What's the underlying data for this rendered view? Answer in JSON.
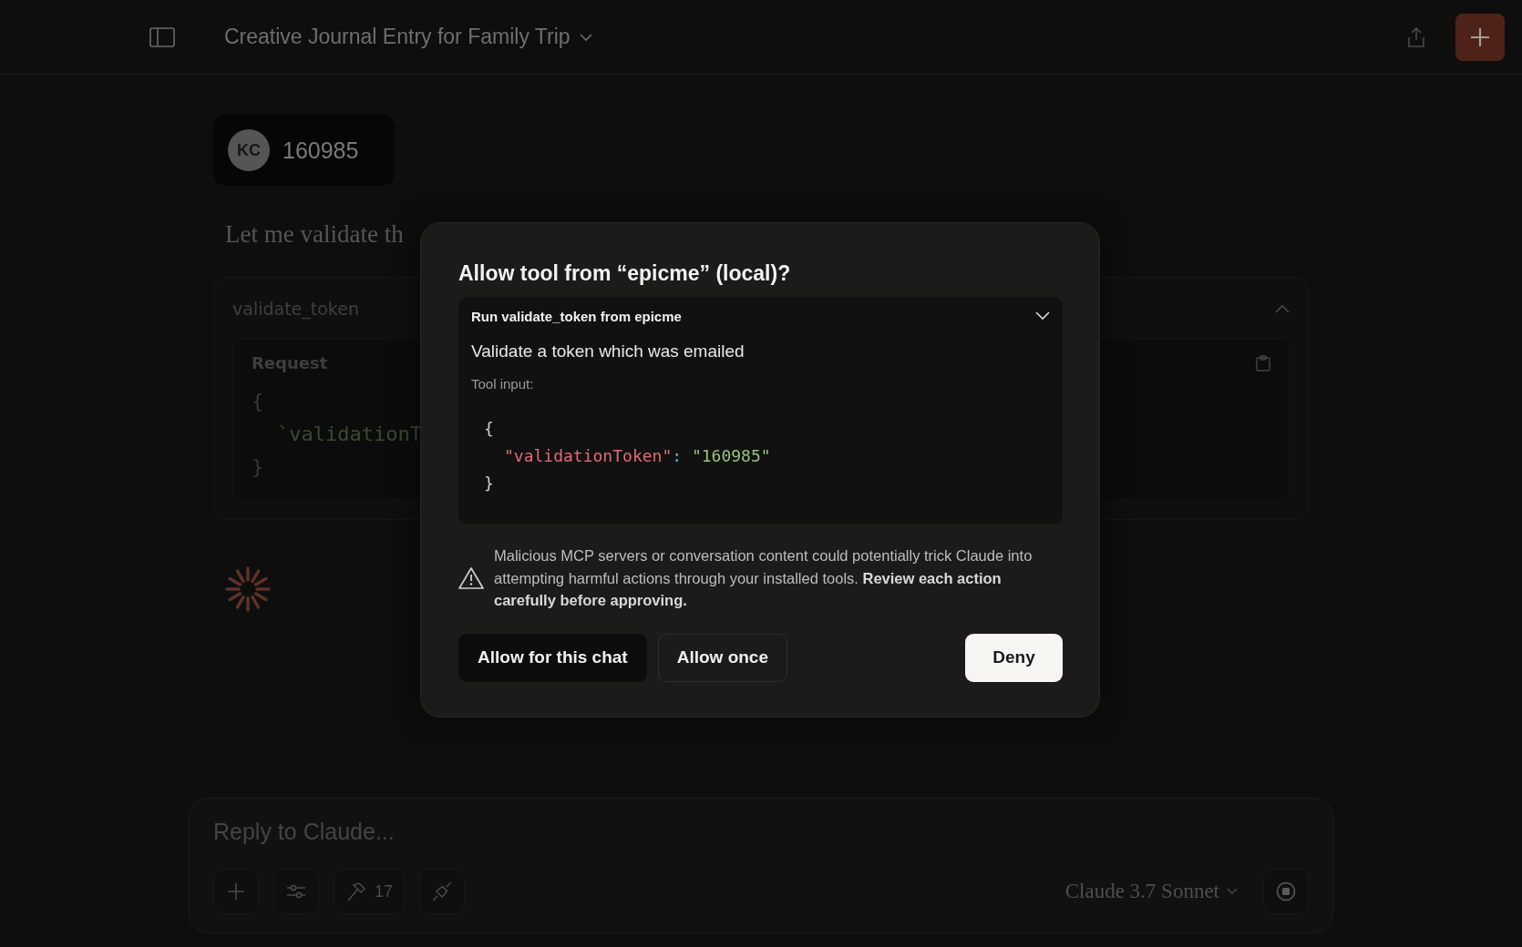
{
  "header": {
    "title": "Creative Journal Entry for Family Trip"
  },
  "messages": [
    {
      "kind": "user",
      "avatar": "KC",
      "text": "160985"
    },
    {
      "kind": "assistant",
      "text": "Let me validate th"
    }
  ],
  "tool_call": {
    "name": "validate_token",
    "expanded": true,
    "request_label": "Request",
    "lines": [
      "{",
      "`validationT",
      "}"
    ]
  },
  "dialog": {
    "title": "Allow tool from “epicme” (local)?",
    "tool_header": "Run validate_token from epicme",
    "description": "Validate a token which was emailed",
    "input_label": "Tool input:",
    "code": {
      "open": "{",
      "key": "\"validationToken\"",
      "colon": ":",
      "value": "\"160985\"",
      "close": "}"
    },
    "warning": "Malicious MCP servers or conversation content could potentially trick Claude into attempting harmful actions through your installed tools. **Review each action carefully before approving.**",
    "buttons": [
      {
        "label": "Allow for this chat",
        "kind": "secondary"
      },
      {
        "label": "Allow once",
        "kind": "outline"
      },
      {
        "label": "Deny",
        "kind": "primary"
      }
    ]
  },
  "composer": {
    "placeholder": "Reply to Claude...",
    "tools_count": "17",
    "model": "Claude 3.7 Sonnet"
  }
}
